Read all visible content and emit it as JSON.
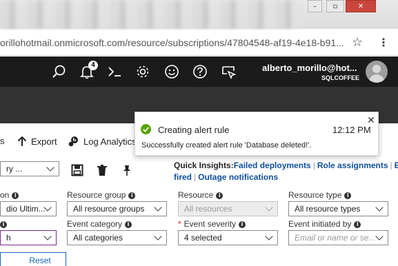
{
  "browser": {
    "url": "orillohotmail.onmicrosoft.com/resource/subscriptions/47804548-af19-4e18-b91...",
    "star_glyph": "☆",
    "menu_glyph": "⋮",
    "win_min": "–",
    "win_max": "▫",
    "win_close": "✕"
  },
  "header": {
    "notifications_count": "4",
    "user_name": "alberto_morillo@hot...",
    "tenant": "SQLCOFFEE",
    "icons": [
      "search-icon",
      "bell-icon",
      "cloud-shell-icon",
      "gear-icon",
      "smiley-icon",
      "help-icon",
      "feedback-icon"
    ]
  },
  "commands": {
    "partial_left": "s",
    "export": "Export",
    "log_analytics": "Log Analytics"
  },
  "filters": {
    "query_value": "ry ...",
    "subscription_label": "on",
    "subscription_value": "dio Ultim...",
    "resource_group_label": "Resource group",
    "resource_group_value": "All resource groups",
    "resource_label": "Resource",
    "resource_value": "All resources",
    "resource_type_label": "Resource type",
    "resource_type_value": "All resource types",
    "event_category_label": "Event category",
    "event_category_value": "All categories",
    "event_severity_label": "Event severity",
    "event_severity_value": "4 selected",
    "event_initiated_label": "Event initiated by",
    "event_initiated_placeholder": "Email or name or se...",
    "timespan_value": "h",
    "reset": "Reset"
  },
  "quick_insights": {
    "label": "Quick Insights:",
    "failed_deployments": "Failed deployments",
    "role_assignments": "Role assignments",
    "partial": "E",
    "fired": "fired",
    "outage_notifications": "Outage notifications"
  },
  "toast": {
    "title": "Creating alert rule",
    "time": "12:12 PM",
    "message": "Successfully created alert rule 'Database deleted!'.",
    "close_glyph": "✕"
  },
  "colors": {
    "header_bg": "#1b1b1b",
    "link": "#0f4f9e",
    "success": "#57a300",
    "close_button": "#c9463d"
  }
}
